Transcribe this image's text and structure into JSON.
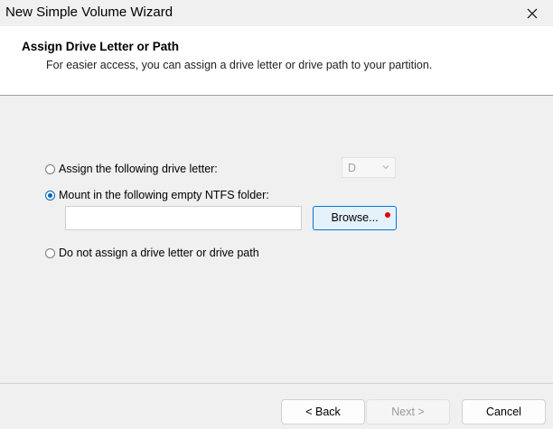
{
  "window": {
    "title": "New Simple Volume Wizard",
    "close_icon": "close-icon"
  },
  "header": {
    "title": "Assign Drive Letter or Path",
    "subtitle": "For easier access, you can assign a drive letter or drive path to your partition."
  },
  "options": {
    "assign_letter": {
      "label": "Assign the following drive letter:",
      "selected": false
    },
    "drive_letter": {
      "value": "D",
      "enabled": false
    },
    "mount_folder": {
      "label": "Mount in the following empty NTFS folder:",
      "selected": true
    },
    "folder_path": {
      "value": "",
      "placeholder": ""
    },
    "browse_label": "Browse...",
    "no_assign": {
      "label": "Do not assign a drive letter or drive path",
      "selected": false
    }
  },
  "footer": {
    "back_label": "< Back",
    "next_label": "Next >",
    "cancel_label": "Cancel"
  },
  "colors": {
    "accent": "#0067c0",
    "browse_focus_border": "#0078d7",
    "marker_dot": "#e00000"
  }
}
